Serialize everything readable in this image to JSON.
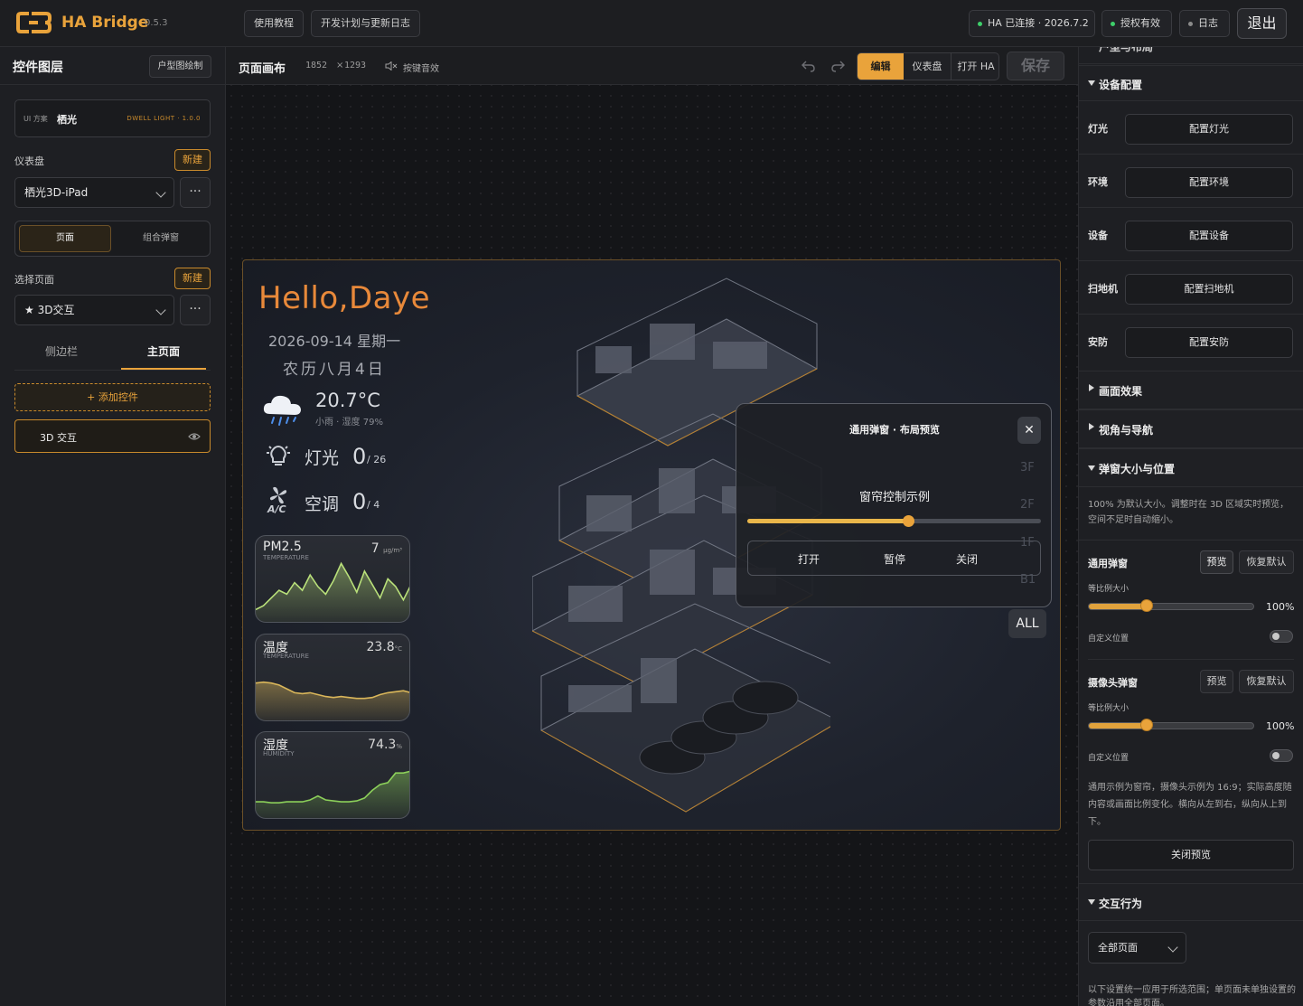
{
  "app": {
    "name": "HA Bridge",
    "version": "0.5.3"
  },
  "topbar": {
    "tutorial": "使用教程",
    "roadmap": "开发计划与更新日志",
    "ha_status": "HA 已连接 · 2026.7.2",
    "license": "授权有效",
    "log": "日志",
    "logout": "退出",
    "colors": {
      "ok": "#3ecf6a",
      "muted": "#8a8a8a"
    }
  },
  "left": {
    "title": "控件图层",
    "floorplan_btn": "户型图绘制",
    "ui_scheme_label": "UI 方案",
    "ui_scheme_name": "栖光",
    "ui_scheme_tag": "DWELL LIGHT · 1.0.0",
    "dashboard_label": "仪表盘",
    "new_label": "新建",
    "dashboard_value": "栖光3D-iPad",
    "more": "···",
    "mode_tabs": [
      "页面",
      "组合弹窗"
    ],
    "page_label": "选择页面",
    "page_value": "★ 3D交互",
    "sub_tabs": [
      "侧边栏",
      "主页面"
    ],
    "add_widget": "+ 添加控件",
    "layer_item": "3D 交互"
  },
  "canvas": {
    "title": "页面画布",
    "size_w": "1852",
    "size_x": "×",
    "size_h": "1293",
    "sound": "按键音效",
    "modes": [
      "编辑",
      "仪表盘",
      "打开 HA"
    ],
    "save": "保存",
    "greeting": "Hello,Daye",
    "date": "2026-09-14 星期一",
    "lunar": "农历八月4日",
    "temp": "20.7°C",
    "weather": "小雨 · 湿度 79%",
    "light_label": "灯光",
    "light_on": "0",
    "light_total": "/ 26",
    "ac_label": "空调",
    "ac_on": "0",
    "ac_total": "/ 4",
    "ac_icon_text": "A/C",
    "floors": [
      "3F",
      "2F",
      "1F",
      "B1"
    ],
    "all": "ALL",
    "accent": "#e8893a"
  },
  "chart_data": [
    {
      "type": "area",
      "title": "PM2.5",
      "subtitle": "TEMPERATURE",
      "value": "7",
      "unit": "μg/m³",
      "values": [
        10,
        14,
        22,
        30,
        26,
        38,
        30,
        46,
        34,
        26,
        40,
        58,
        44,
        28,
        50,
        36,
        22,
        42,
        34,
        20,
        36
      ],
      "ylim": [
        0,
        70
      ],
      "color": "#b9e07a"
    },
    {
      "type": "area",
      "title": "温度",
      "subtitle": "TEMPERATURE",
      "value": "23.8",
      "unit": "°C",
      "values": [
        36,
        37,
        36,
        34,
        30,
        26,
        25,
        26,
        24,
        22,
        21,
        22,
        21,
        20,
        20,
        21,
        24,
        26,
        27,
        28,
        26
      ],
      "ylim": [
        0,
        70
      ],
      "color": "#d9b65a"
    },
    {
      "type": "area",
      "title": "湿度",
      "subtitle": "HUMIDITY",
      "value": "74.3",
      "unit": "%",
      "values": [
        14,
        14,
        13,
        13,
        14,
        14,
        14,
        16,
        20,
        16,
        15,
        14,
        14,
        15,
        18,
        26,
        32,
        34,
        44,
        44,
        46
      ],
      "ylim": [
        0,
        70
      ],
      "color": "#8cd05a"
    }
  ],
  "popup": {
    "title": "通用弹窗 · 布局预览",
    "close": "✕",
    "subtitle": "窗帘控制示例",
    "progress": 0.55,
    "buttons": [
      "打开",
      "暂停",
      "关闭"
    ]
  },
  "right": {
    "cut_title": "户型与布局",
    "device_config": "设备配置",
    "devices": [
      {
        "label": "灯光",
        "btn": "配置灯光"
      },
      {
        "label": "环境",
        "btn": "配置环境"
      },
      {
        "label": "设备",
        "btn": "配置设备"
      },
      {
        "label": "扫地机",
        "btn": "配置扫地机"
      },
      {
        "label": "安防",
        "btn": "配置安防"
      }
    ],
    "effects": "画面效果",
    "view_nav": "视角与导航",
    "popup_size": "弹窗大小与位置",
    "popup_note": "100% 为默认大小。调整时在 3D 区域实时预览，空间不足时自动缩小。",
    "general_popup": "通用弹窗",
    "camera_popup": "摄像头弹窗",
    "preview": "预览",
    "reset": "恢复默认",
    "scale_label": "等比例大小",
    "general_scale": "100%",
    "camera_scale": "100%",
    "general_scale_level": 0.35,
    "camera_scale_level": 0.35,
    "custom_pos": "自定义位置",
    "footnote": "通用示例为窗帘，摄像头示例为 16:9；实际高度随内容或画面比例变化。横向从左到右，纵向从上到下。",
    "close_preview": "关闭预览",
    "interaction": "交互行为",
    "scope_value": "全部页面",
    "scope_note": "以下设置统一应用于所选范围；单页面未单独设置的参数沿用全部页面。"
  }
}
